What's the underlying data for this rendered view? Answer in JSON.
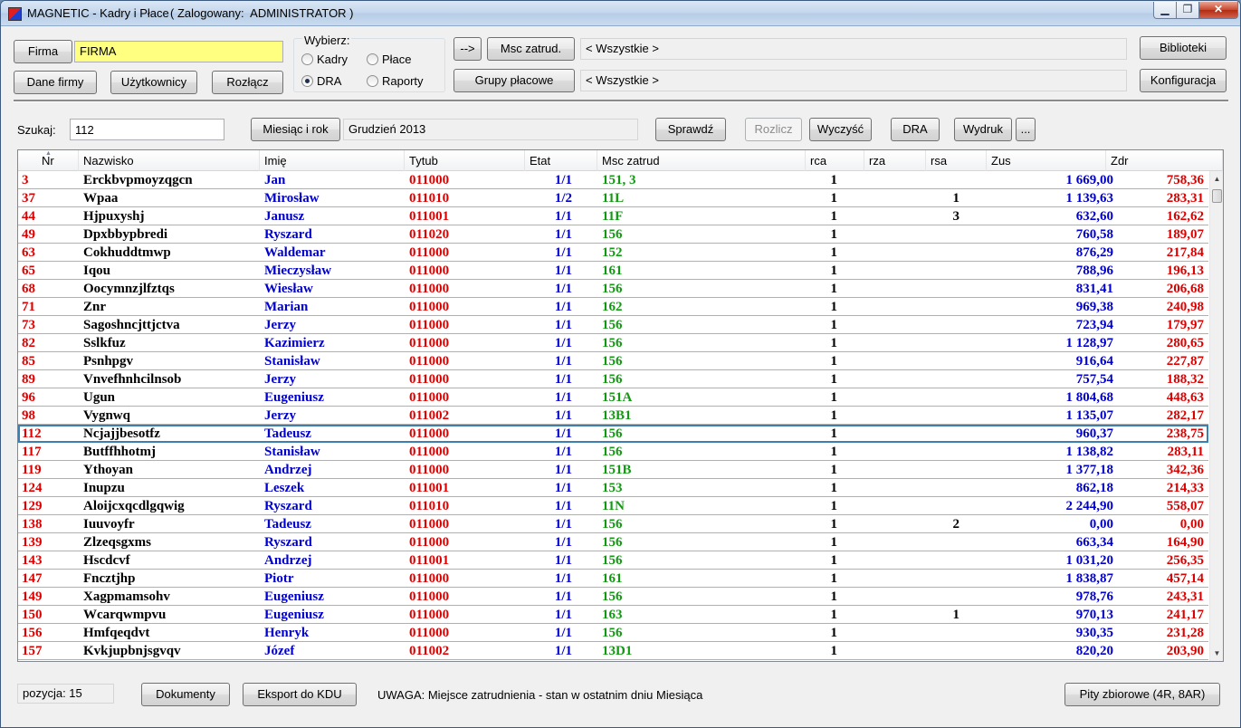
{
  "window": {
    "title": "MAGNETIC - Kadry i Płace",
    "logged_in": "( Zalogowany:  ADMINISTRATOR )",
    "minimize": "▁",
    "maximize": "❐",
    "close": "✕"
  },
  "top": {
    "firma_button": "Firma",
    "firma_value": "FIRMA",
    "dane_firmy": "Dane firmy",
    "uzytkownicy": "Użytkownicy",
    "rozlacz": "Rozłącz",
    "wybierz_label": "Wybierz:",
    "radio_kadry": "Kadry",
    "radio_place": "Płace",
    "radio_dra": "DRA",
    "radio_raporty": "Raporty",
    "selected_mode": "DRA",
    "arrow_button": "-->",
    "msc_zatrud_button": "Msc zatrud.",
    "msc_zatrud_value": "< Wszystkie >",
    "grupy_placowe_button": "Grupy płacowe",
    "grupy_placowe_value": "< Wszystkie >",
    "biblioteki": "Biblioteki",
    "konfiguracja": "Konfiguracja"
  },
  "search": {
    "label": "Szukaj:",
    "value": "112",
    "miesiac_button": "Miesiąc i rok",
    "miesiac_value": "Grudzień  2013",
    "sprawdz": "Sprawdź",
    "rozlicz": "Rozlicz",
    "wyczysc": "Wyczyść",
    "dra": "DRA",
    "wydruk": "Wydruk",
    "more": "..."
  },
  "grid": {
    "columns": [
      "Nr",
      "Nazwisko",
      "Imię",
      "Tytub",
      "Etat",
      "Msc zatrud",
      "rca",
      "rza",
      "rsa",
      "Zus",
      "Zdr"
    ],
    "sort_indicator": "▲",
    "selected_index": 14,
    "rows": [
      {
        "nr": "3",
        "nazwisko": "Erckbvpmoyzqgcn",
        "imie": "Jan",
        "tytub": "011000",
        "etat": "1/1",
        "msc": "151, 3",
        "rca": "1",
        "rza": "",
        "rsa": "",
        "zus": "1 669,00",
        "zdr": "758,36"
      },
      {
        "nr": "37",
        "nazwisko": "Wpaa",
        "imie": "Mirosław",
        "tytub": "011010",
        "etat": "1/2",
        "msc": "11L",
        "rca": "1",
        "rza": "",
        "rsa": "1",
        "zus": "1 139,63",
        "zdr": "283,31"
      },
      {
        "nr": "44",
        "nazwisko": "Hjpuxyshj",
        "imie": "Janusz",
        "tytub": "011001",
        "etat": "1/1",
        "msc": "11F",
        "rca": "1",
        "rza": "",
        "rsa": "3",
        "zus": "632,60",
        "zdr": "162,62"
      },
      {
        "nr": "49",
        "nazwisko": "Dpxbbypbredi",
        "imie": "Ryszard",
        "tytub": "011020",
        "etat": "1/1",
        "msc": "156",
        "rca": "1",
        "rza": "",
        "rsa": "",
        "zus": "760,58",
        "zdr": "189,07"
      },
      {
        "nr": "63",
        "nazwisko": "Cokhuddtmwp",
        "imie": "Waldemar",
        "tytub": "011000",
        "etat": "1/1",
        "msc": "152",
        "rca": "1",
        "rza": "",
        "rsa": "",
        "zus": "876,29",
        "zdr": "217,84"
      },
      {
        "nr": "65",
        "nazwisko": "Iqou",
        "imie": "Mieczysław",
        "tytub": "011000",
        "etat": "1/1",
        "msc": "161",
        "rca": "1",
        "rza": "",
        "rsa": "",
        "zus": "788,96",
        "zdr": "196,13"
      },
      {
        "nr": "68",
        "nazwisko": "Oocymnzjlfztqs",
        "imie": "Wiesław",
        "tytub": "011000",
        "etat": "1/1",
        "msc": "156",
        "rca": "1",
        "rza": "",
        "rsa": "",
        "zus": "831,41",
        "zdr": "206,68"
      },
      {
        "nr": "71",
        "nazwisko": "Znr",
        "imie": "Marian",
        "tytub": "011000",
        "etat": "1/1",
        "msc": "162",
        "rca": "1",
        "rza": "",
        "rsa": "",
        "zus": "969,38",
        "zdr": "240,98"
      },
      {
        "nr": "73",
        "nazwisko": "Sagoshncjttjctva",
        "imie": "Jerzy",
        "tytub": "011000",
        "etat": "1/1",
        "msc": "156",
        "rca": "1",
        "rza": "",
        "rsa": "",
        "zus": "723,94",
        "zdr": "179,97"
      },
      {
        "nr": "82",
        "nazwisko": "Sslkfuz",
        "imie": "Kazimierz",
        "tytub": "011000",
        "etat": "1/1",
        "msc": "156",
        "rca": "1",
        "rza": "",
        "rsa": "",
        "zus": "1 128,97",
        "zdr": "280,65"
      },
      {
        "nr": "85",
        "nazwisko": "Psnhpgv",
        "imie": "Stanisław",
        "tytub": "011000",
        "etat": "1/1",
        "msc": "156",
        "rca": "1",
        "rza": "",
        "rsa": "",
        "zus": "916,64",
        "zdr": "227,87"
      },
      {
        "nr": "89",
        "nazwisko": "Vnvefhnhcilnsob",
        "imie": "Jerzy",
        "tytub": "011000",
        "etat": "1/1",
        "msc": "156",
        "rca": "1",
        "rza": "",
        "rsa": "",
        "zus": "757,54",
        "zdr": "188,32"
      },
      {
        "nr": "96",
        "nazwisko": "Ugun",
        "imie": "Eugeniusz",
        "tytub": "011000",
        "etat": "1/1",
        "msc": "151A",
        "rca": "1",
        "rza": "",
        "rsa": "",
        "zus": "1 804,68",
        "zdr": "448,63"
      },
      {
        "nr": "98",
        "nazwisko": "Vygnwq",
        "imie": "Jerzy",
        "tytub": "011002",
        "etat": "1/1",
        "msc": "13B1",
        "rca": "1",
        "rza": "",
        "rsa": "",
        "zus": "1 135,07",
        "zdr": "282,17"
      },
      {
        "nr": "112",
        "nazwisko": "Ncjajjbesotfz",
        "imie": "Tadeusz",
        "tytub": "011000",
        "etat": "1/1",
        "msc": "156",
        "rca": "1",
        "rza": "",
        "rsa": "",
        "zus": "960,37",
        "zdr": "238,75"
      },
      {
        "nr": "117",
        "nazwisko": "Butffhhotmj",
        "imie": "Stanisław",
        "tytub": "011000",
        "etat": "1/1",
        "msc": "156",
        "rca": "1",
        "rza": "",
        "rsa": "",
        "zus": "1 138,82",
        "zdr": "283,11"
      },
      {
        "nr": "119",
        "nazwisko": "Ythoyan",
        "imie": "Andrzej",
        "tytub": "011000",
        "etat": "1/1",
        "msc": "151B",
        "rca": "1",
        "rza": "",
        "rsa": "",
        "zus": "1 377,18",
        "zdr": "342,36"
      },
      {
        "nr": "124",
        "nazwisko": "Inupzu",
        "imie": "Leszek",
        "tytub": "011001",
        "etat": "1/1",
        "msc": "153",
        "rca": "1",
        "rza": "",
        "rsa": "",
        "zus": "862,18",
        "zdr": "214,33"
      },
      {
        "nr": "129",
        "nazwisko": "Aloijcxqcdlgqwig",
        "imie": "Ryszard",
        "tytub": "011010",
        "etat": "1/1",
        "msc": "11N",
        "rca": "1",
        "rza": "",
        "rsa": "",
        "zus": "2 244,90",
        "zdr": "558,07"
      },
      {
        "nr": "138",
        "nazwisko": "Iuuvoyfr",
        "imie": "Tadeusz",
        "tytub": "011000",
        "etat": "1/1",
        "msc": "156",
        "rca": "1",
        "rza": "",
        "rsa": "2",
        "zus": "0,00",
        "zdr": "0,00"
      },
      {
        "nr": "139",
        "nazwisko": "Zlzeqsgxms",
        "imie": "Ryszard",
        "tytub": "011000",
        "etat": "1/1",
        "msc": "156",
        "rca": "1",
        "rza": "",
        "rsa": "",
        "zus": "663,34",
        "zdr": "164,90"
      },
      {
        "nr": "143",
        "nazwisko": "Hscdcvf",
        "imie": "Andrzej",
        "tytub": "011001",
        "etat": "1/1",
        "msc": "156",
        "rca": "1",
        "rza": "",
        "rsa": "",
        "zus": "1 031,20",
        "zdr": "256,35"
      },
      {
        "nr": "147",
        "nazwisko": "Fncztjhp",
        "imie": "Piotr",
        "tytub": "011000",
        "etat": "1/1",
        "msc": "161",
        "rca": "1",
        "rza": "",
        "rsa": "",
        "zus": "1 838,87",
        "zdr": "457,14"
      },
      {
        "nr": "149",
        "nazwisko": "Xagpmamsohv",
        "imie": "Eugeniusz",
        "tytub": "011000",
        "etat": "1/1",
        "msc": "156",
        "rca": "1",
        "rza": "",
        "rsa": "",
        "zus": "978,76",
        "zdr": "243,31"
      },
      {
        "nr": "150",
        "nazwisko": "Wcarqwmpvu",
        "imie": "Eugeniusz",
        "tytub": "011000",
        "etat": "1/1",
        "msc": "163",
        "rca": "1",
        "rza": "",
        "rsa": "1",
        "zus": "970,13",
        "zdr": "241,17"
      },
      {
        "nr": "156",
        "nazwisko": "Hmfqeqdvt",
        "imie": "Henryk",
        "tytub": "011000",
        "etat": "1/1",
        "msc": "156",
        "rca": "1",
        "rza": "",
        "rsa": "",
        "zus": "930,35",
        "zdr": "231,28"
      },
      {
        "nr": "157",
        "nazwisko": "Kvkjupbnjsgvqv",
        "imie": "Józef",
        "tytub": "011002",
        "etat": "1/1",
        "msc": "13D1",
        "rca": "1",
        "rza": "",
        "rsa": "",
        "zus": "820,20",
        "zdr": "203,90"
      }
    ]
  },
  "bottom": {
    "pozycja": "pozycja:  15",
    "dokumenty": "Dokumenty",
    "eksport": "Eksport do KDU",
    "uwaga": "UWAGA:  Miejsce zatrudnienia - stan w ostatnim dniu Miesiąca",
    "pity": "Pity zbiorowe (4R, 8AR)"
  },
  "colors": {
    "nr": "#dd0000",
    "imie": "#0000cc",
    "msc": "#119911",
    "firma_field": "#ffff80",
    "selection": "#3c7fb1"
  },
  "icons": {
    "app": "magnetic-app-icon",
    "scroll_up": "▲",
    "scroll_down": "▼"
  }
}
